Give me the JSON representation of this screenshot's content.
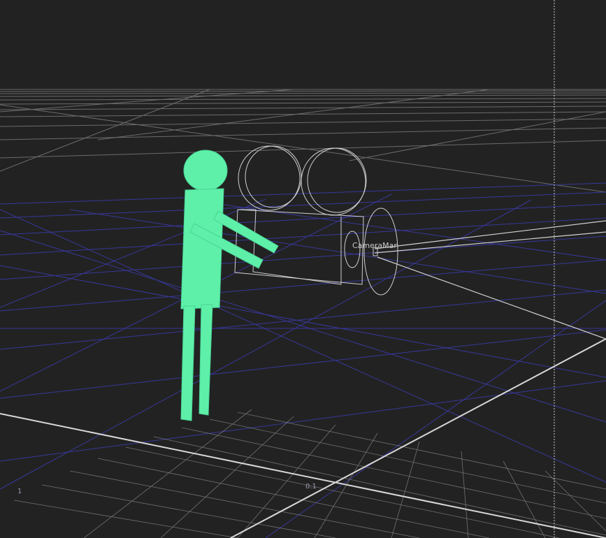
{
  "viewport": {
    "background": "#222222",
    "grid_color": "#8a8a8a",
    "blue_grid_color": "#3a3aa8",
    "figure_color": "#5ef0a8",
    "wire_color": "#cfcfcf"
  },
  "scene": {
    "camera_label": "CameraMan",
    "axis_label_x": "0.1",
    "axis_label_left": "1"
  },
  "icons": {
    "camera": "movie-camera-wireframe",
    "figure": "stick-figure"
  }
}
